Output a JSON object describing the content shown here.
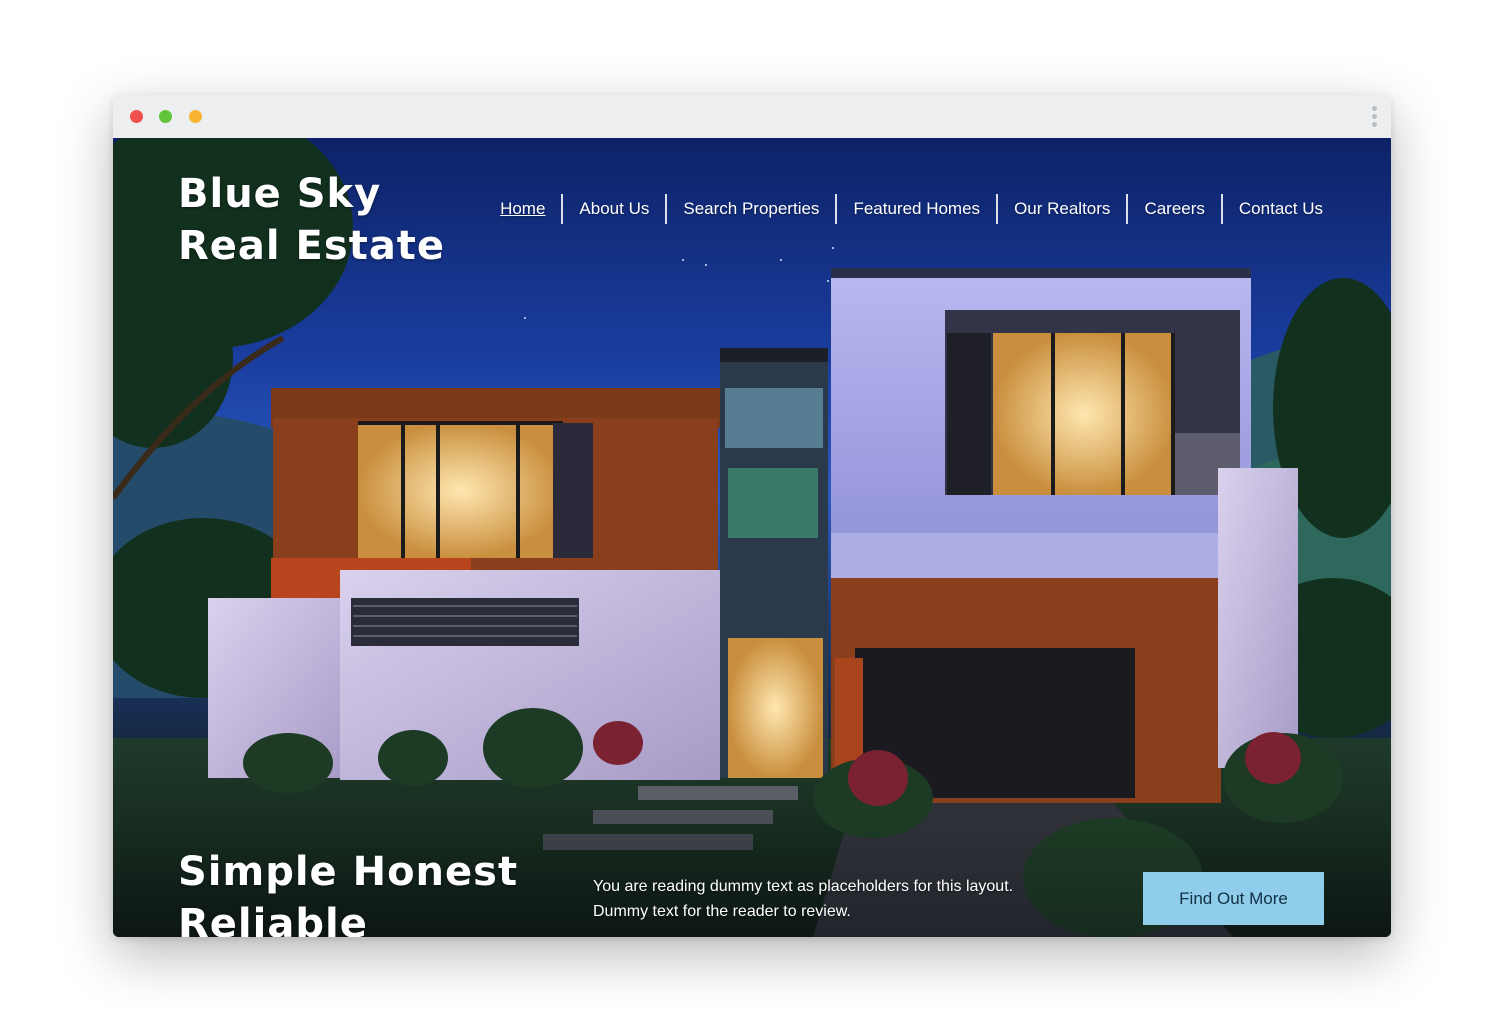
{
  "browser": {
    "controls": [
      "close-dot",
      "minimize-dot",
      "maximize-dot"
    ],
    "menu_icon": "kebab-menu-icon"
  },
  "site": {
    "logo_line1": "Blue Sky",
    "logo_line2": "Real Estate"
  },
  "nav": {
    "items": [
      {
        "label": "Home",
        "active": true
      },
      {
        "label": "About Us",
        "active": false
      },
      {
        "label": "Search Properties",
        "active": false
      },
      {
        "label": "Featured Homes",
        "active": false
      },
      {
        "label": "Our Realtors",
        "active": false
      },
      {
        "label": "Careers",
        "active": false
      },
      {
        "label": "Contact Us",
        "active": false
      }
    ]
  },
  "hero": {
    "tagline_line1": "Simple Honest",
    "tagline_line2": "Reliable",
    "description_line1": "You are reading dummy text as placeholders for this layout.",
    "description_line2": "Dummy text for the reader to review.",
    "cta_label": "Find Out More"
  },
  "colors": {
    "cta_background": "#8fcdea",
    "titlebar": "#eceeef",
    "dot_red": "#f0514e",
    "dot_green": "#62c43a",
    "dot_yellow": "#f8b532"
  }
}
